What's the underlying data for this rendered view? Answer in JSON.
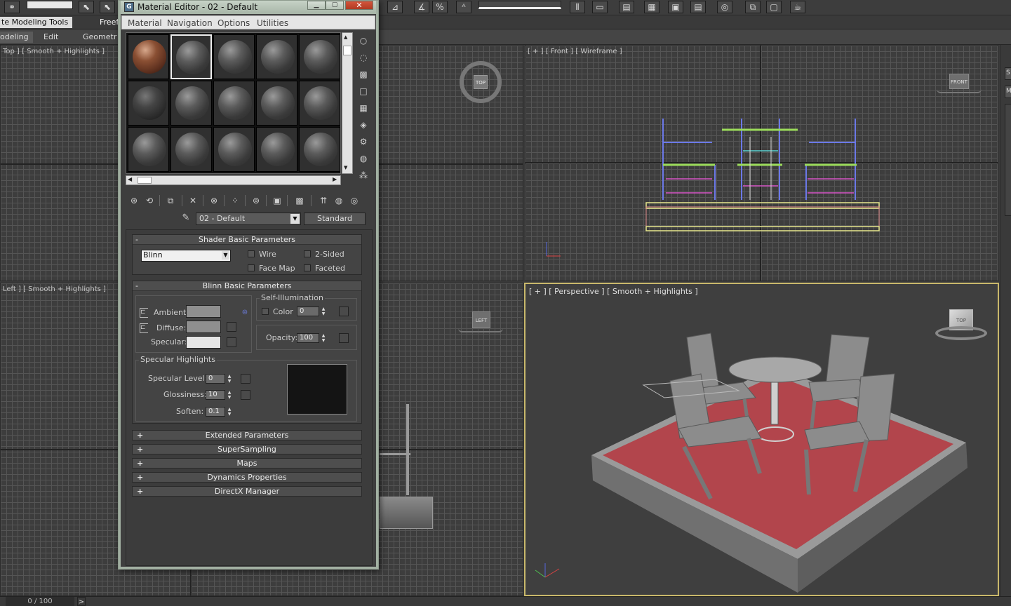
{
  "ribbon": {
    "tab_modeling_tools": "te Modeling Tools",
    "tab_freeform": "Freef",
    "tab_modeling": "odeling",
    "tab_edit": "Edit",
    "tab_geometry": "Geometr"
  },
  "viewports": {
    "top_label": "Top ] [ Smooth + Highlights ]",
    "front_label": "[ + ] [ Front ] [ Wireframe ]",
    "left_label": "Left ] [ Smooth + Highlights ]",
    "perspective_label": "[ + ] [ Perspective ] [ Smooth + Highlights ]",
    "viewcube_top": "TOP",
    "viewcube_front": "FRONT",
    "viewcube_left": "LEFT",
    "viewcube_persp": "TOP"
  },
  "material_editor": {
    "title": "Material Editor - 02 - Default",
    "menu": [
      "Material",
      "Navigation",
      "Options",
      "Utilities"
    ],
    "current_material": "02 - Default",
    "material_type": "Standard",
    "shader_panel": {
      "title": "Shader Basic Parameters",
      "toggle": "-",
      "shader": "Blinn",
      "wire": "Wire",
      "two_sided": "2-Sided",
      "face_map": "Face Map",
      "faceted": "Faceted"
    },
    "blinn_panel": {
      "title": "Blinn Basic Parameters",
      "toggle": "-",
      "ambient": "Ambient:",
      "diffuse": "Diffuse:",
      "specular": "Specular:",
      "self_illum_title": "Self-Illumination",
      "color": "Color",
      "self_illum_value": "0",
      "opacity_label": "Opacity:",
      "opacity_value": "100",
      "spec_highlights_title": "Specular Highlights",
      "specular_level_label": "Specular Level:",
      "specular_level_value": "0",
      "glossiness_label": "Glossiness:",
      "glossiness_value": "10",
      "soften_label": "Soften:",
      "soften_value": "0.1"
    },
    "rollouts": [
      {
        "toggle": "+",
        "label": "Extended Parameters"
      },
      {
        "toggle": "+",
        "label": "SuperSampling"
      },
      {
        "toggle": "+",
        "label": "Maps"
      },
      {
        "toggle": "+",
        "label": "Dynamics Properties"
      },
      {
        "toggle": "+",
        "label": "DirectX Manager"
      }
    ],
    "colors": {
      "ambient": "#8f8f8f",
      "diffuse": "#8f8f8f",
      "specular": "#e6e6e6",
      "titlebar": "#b6c3b6"
    }
  },
  "status": {
    "progress": "0 / 100",
    "next": ">"
  },
  "side_panel": {
    "label_s": "S",
    "label_m": "M"
  }
}
